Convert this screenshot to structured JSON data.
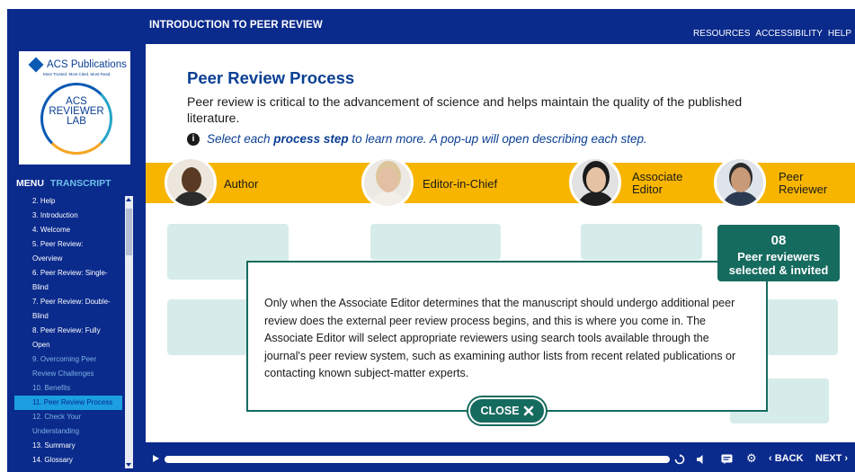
{
  "header": {
    "course_title": "INTRODUCTION TO PEER REVIEW",
    "links": [
      "RESOURCES",
      "ACCESSIBILITY",
      "HELP"
    ]
  },
  "logo": {
    "publisher": "ACS Publications",
    "tagline": "Most Trusted. Most Cited. Most Read.",
    "lab_line1": "ACS",
    "lab_line2": "REVIEWER",
    "lab_line3": "LAB"
  },
  "sidebar": {
    "tabs": {
      "menu": "MENU",
      "transcript": "TRANSCRIPT"
    },
    "items": [
      {
        "label": "2. Help",
        "state": "normal"
      },
      {
        "label": "3. Introduction",
        "state": "normal"
      },
      {
        "label": "4. Welcome",
        "state": "normal"
      },
      {
        "label": "5. Peer Review:",
        "state": "normal"
      },
      {
        "label": "Overview",
        "state": "normal"
      },
      {
        "label": "6. Peer Review: Single-",
        "state": "normal"
      },
      {
        "label": "Blind",
        "state": "normal"
      },
      {
        "label": "7. Peer Review: Double-",
        "state": "normal"
      },
      {
        "label": "Blind",
        "state": "normal"
      },
      {
        "label": "8. Peer Review: Fully",
        "state": "normal"
      },
      {
        "label": "Open",
        "state": "normal"
      },
      {
        "label": "9. Overcoming Peer",
        "state": "visited"
      },
      {
        "label": "Review Challenges",
        "state": "visited"
      },
      {
        "label": "10. Benefits",
        "state": "visited"
      },
      {
        "label": "11. Peer Review Process",
        "state": "current"
      },
      {
        "label": "12. Check Your",
        "state": "visited"
      },
      {
        "label": "Understanding",
        "state": "visited"
      },
      {
        "label": "13. Summary",
        "state": "normal"
      },
      {
        "label": "14. Glossary",
        "state": "normal"
      }
    ]
  },
  "main": {
    "heading": "Peer Review Process",
    "intro": "Peer review is critical to the advancement of science and helps maintain the quality of the published literature.",
    "instruction_before": "Select each ",
    "instruction_bold": "process step",
    "instruction_after": " to learn more. A pop-up will open describing each step.",
    "roles": [
      {
        "label": "Author"
      },
      {
        "label": "Editor-in-Chief"
      },
      {
        "label_line1": "Associate",
        "label_line2": "Editor"
      },
      {
        "label_line1": "Peer",
        "label_line2": "Reviewer"
      }
    ]
  },
  "popup": {
    "text": "Only when the Associate Editor determines that the manuscript should undergo additional peer review does the external peer review process begins, and this is where you come in. The Associate Editor will select appropriate reviewers using search tools available through the journal's peer review system, such as examining author lists from recent related publications or contacting known subject-matter experts.",
    "close_label": "CLOSE",
    "badge_number": "08",
    "badge_line1": "Peer reviewers",
    "badge_line2": "selected & invited"
  },
  "player": {
    "back_label": "BACK",
    "next_label": "NEXT"
  },
  "colors": {
    "shell": "#0a2a8c",
    "heading": "#0a3f93",
    "band": "#f7b500",
    "teal": "#166b5f",
    "current_item": "#1b9fe0"
  }
}
